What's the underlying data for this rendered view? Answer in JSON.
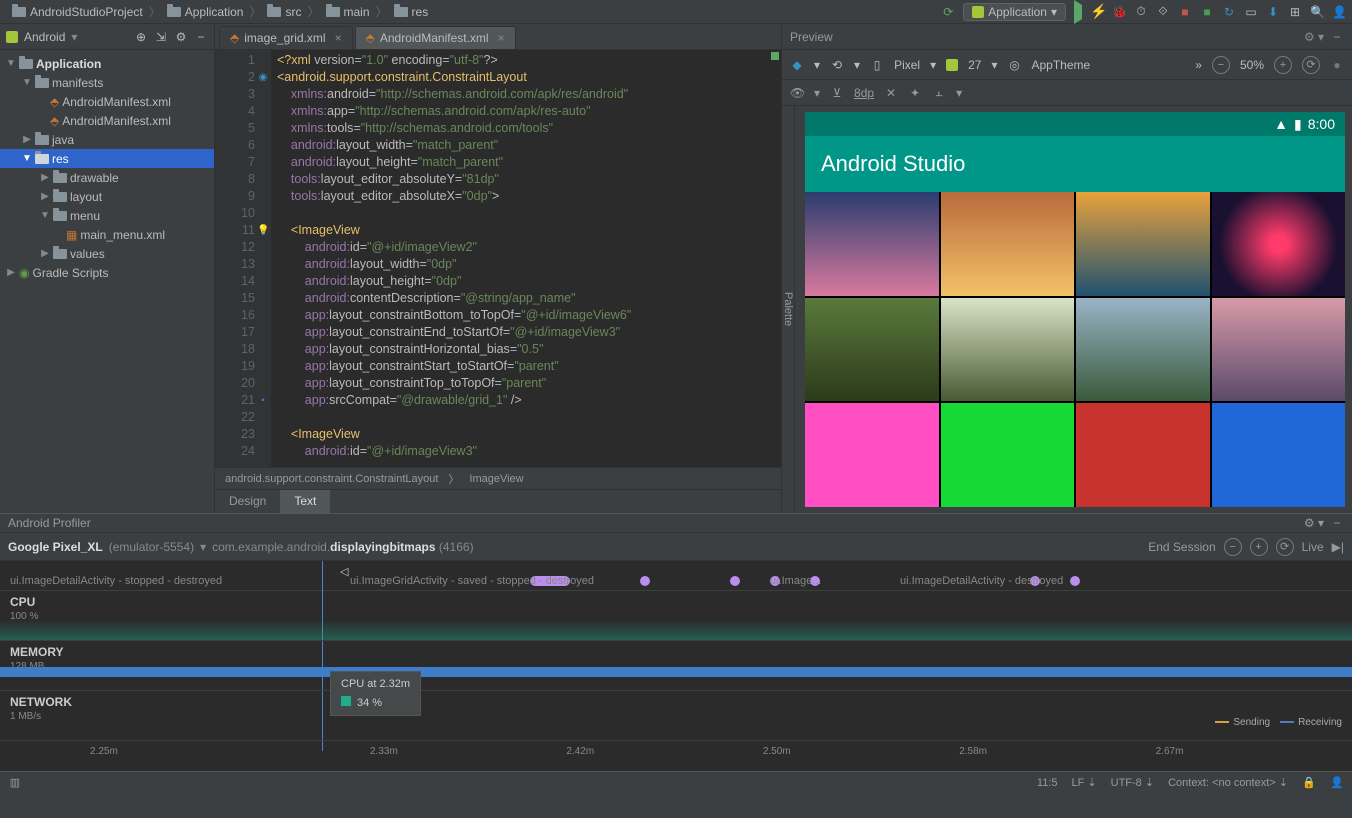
{
  "breadcrumbs": [
    "AndroidStudioProject",
    "Application",
    "src",
    "main",
    "res"
  ],
  "run_config": "Application",
  "project_view_mode": "Android",
  "tree": {
    "root": "Application",
    "manifests": "manifests",
    "manifest_file": "AndroidManifest.xml",
    "manifest_file2": "AndroidManifest.xml",
    "java": "java",
    "res": "res",
    "drawable": "drawable",
    "layout": "layout",
    "menu": "menu",
    "main_menu": "main_menu.xml",
    "values": "values",
    "gradle": "Gradle Scripts"
  },
  "tabs": {
    "t1": "image_grid.xml",
    "t2": "AndroidManifest.xml"
  },
  "gutter_start": 1,
  "gutter_end": 24,
  "code_lines": [
    {
      "t": "<?xml version=\"1.0\" encoding=\"utf-8\"?>",
      "cls": "c-kw"
    },
    {
      "t": "<android.support.constraint.ConstraintLayout",
      "cls": "c-kw"
    },
    {
      "t": "    xmlns:android=\"http://schemas.android.com/apk/res/android\"",
      "cls": ""
    },
    {
      "t": "    xmlns:app=\"http://schemas.android.com/apk/res-auto\"",
      "cls": ""
    },
    {
      "t": "    xmlns:tools=\"http://schemas.android.com/tools\"",
      "cls": ""
    },
    {
      "t": "    android:layout_width=\"match_parent\"",
      "cls": ""
    },
    {
      "t": "    android:layout_height=\"match_parent\"",
      "cls": ""
    },
    {
      "t": "    tools:layout_editor_absoluteY=\"81dp\"",
      "cls": ""
    },
    {
      "t": "    tools:layout_editor_absoluteX=\"0dp\">",
      "cls": ""
    },
    {
      "t": "",
      "cls": ""
    },
    {
      "t": "    <ImageView",
      "cls": "c-kw"
    },
    {
      "t": "        android:id=\"@+id/imageView2\"",
      "cls": ""
    },
    {
      "t": "        android:layout_width=\"0dp\"",
      "cls": ""
    },
    {
      "t": "        android:layout_height=\"0dp\"",
      "cls": ""
    },
    {
      "t": "        android:contentDescription=\"@string/app_name\"",
      "cls": ""
    },
    {
      "t": "        app:layout_constraintBottom_toTopOf=\"@+id/imageView6\"",
      "cls": ""
    },
    {
      "t": "        app:layout_constraintEnd_toStartOf=\"@+id/imageView3\"",
      "cls": ""
    },
    {
      "t": "        app:layout_constraintHorizontal_bias=\"0.5\"",
      "cls": ""
    },
    {
      "t": "        app:layout_constraintStart_toStartOf=\"parent\"",
      "cls": ""
    },
    {
      "t": "        app:layout_constraintTop_toTopOf=\"parent\"",
      "cls": ""
    },
    {
      "t": "        app:srcCompat=\"@drawable/grid_1\" />",
      "cls": ""
    },
    {
      "t": "",
      "cls": ""
    },
    {
      "t": "    <ImageView",
      "cls": "c-kw"
    },
    {
      "t": "        android:id=\"@+id/imageView3\"",
      "cls": ""
    }
  ],
  "breadcrumb_bar": {
    "a": "android.support.constraint.ConstraintLayout",
    "b": "ImageView"
  },
  "mode_tabs": {
    "design": "Design",
    "text": "Text"
  },
  "preview": {
    "title": "Preview",
    "palette": "Palette",
    "device": "Pixel",
    "api": "27",
    "theme": "AppTheme",
    "zoom": "50%",
    "dp": "8dp",
    "statusbar_time": "8:00",
    "app_title": "Android Studio"
  },
  "profiler": {
    "title": "Android Profiler",
    "device": "Google Pixel_XL",
    "emulator": "(emulator-5554)",
    "process_pre": "com.example.android.",
    "process_bold": "displayingbitmaps",
    "pid": "(4166)",
    "end": "End Session",
    "live": "Live",
    "activities": {
      "a1": "ui.ImageDetailActivity - stopped - destroyed",
      "a2": "ui.ImageGridActivity - saved - stopped - destroyed",
      "a3": "ui.Image...",
      "a4": "ui.ImageDetailActivity - destroyed"
    },
    "cpu": {
      "label": "CPU",
      "sub": "100 %"
    },
    "memory": {
      "label": "MEMORY",
      "sub": "128 MB"
    },
    "network": {
      "label": "NETWORK",
      "sub": "1 MB/s"
    },
    "legend": {
      "send": "Sending",
      "recv": "Receiving"
    },
    "tooltip": {
      "title": "CPU at 2.32m",
      "value": "34 %"
    },
    "times": [
      "2.25m",
      "2.33m",
      "2.42m",
      "2.50m",
      "2.58m",
      "2.67m"
    ]
  },
  "statusbar": {
    "pos": "11:5",
    "le": "LF",
    "enc": "UTF-8",
    "ctx": "Context: <no context>"
  }
}
